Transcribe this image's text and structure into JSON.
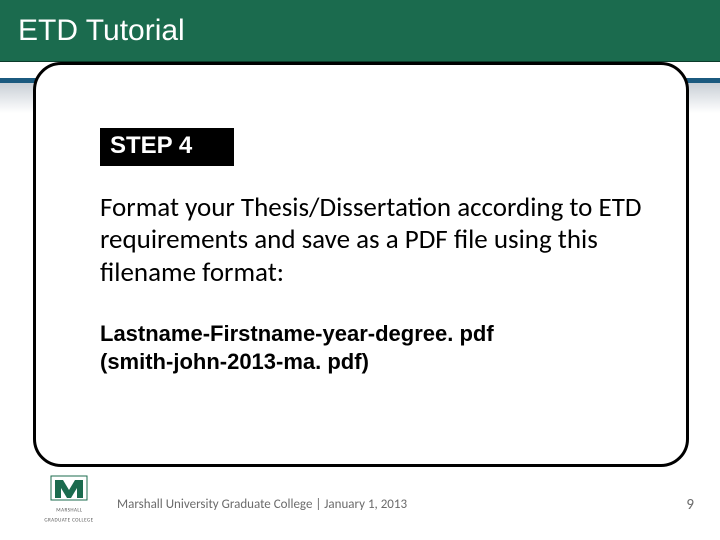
{
  "header": {
    "title": "ETD Tutorial"
  },
  "step": {
    "label": "STEP 4"
  },
  "body": "Format your Thesis/Dissertation according to ETD requirements and save as a PDF file using this filename format:",
  "filename": {
    "pattern": "Lastname-Firstname-year-degree. pdf",
    "example": "(smith-john-2013-ma. pdf)"
  },
  "logo": {
    "line1": "MARSHALL",
    "line2": "GRADUATE COLLEGE"
  },
  "footer": {
    "text": "Marshall University Graduate College | January 1, 2013"
  },
  "page": {
    "number": "9"
  },
  "colors": {
    "header_bg": "#1b6b4e",
    "divider": "#1b5a7f"
  }
}
